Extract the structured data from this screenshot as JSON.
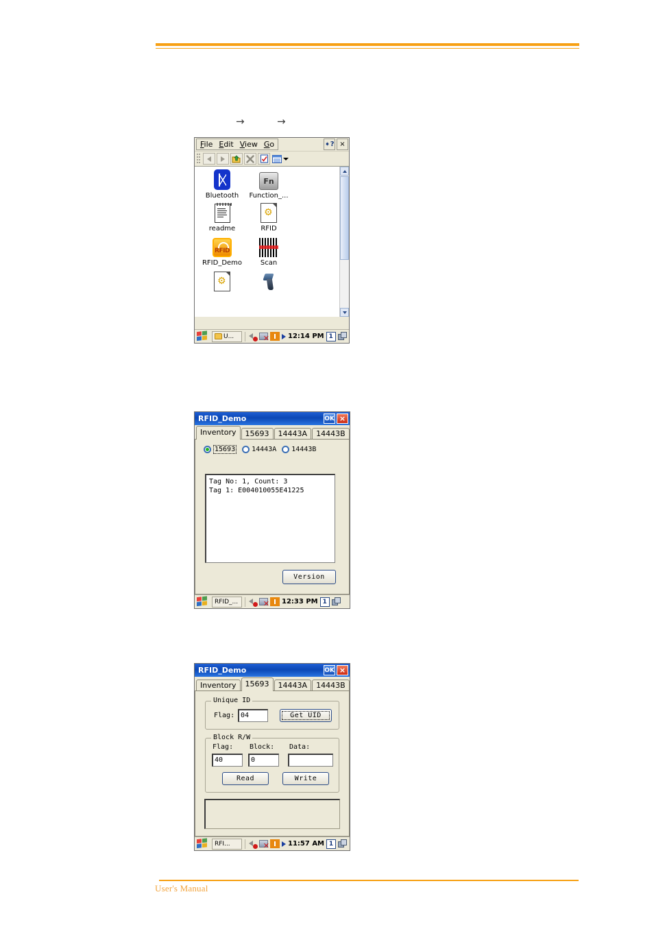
{
  "document": {
    "footer_text": "User's Manual",
    "arrows": [
      "→",
      "→"
    ]
  },
  "explorer_window": {
    "menu": [
      {
        "label": "File",
        "accel": "F"
      },
      {
        "label": "Edit",
        "accel": "E"
      },
      {
        "label": "View",
        "accel": "V"
      },
      {
        "label": "Go",
        "accel": "G"
      }
    ],
    "title_buttons": {
      "help": "?",
      "close": "×"
    },
    "toolbar": [
      "back-button",
      "forward-button",
      "up-one-level-button",
      "delete-button",
      "properties-button",
      "views-button"
    ],
    "icons": [
      {
        "label": "Bluetooth",
        "icon": "bluetooth-icon"
      },
      {
        "label": "Function_...",
        "icon": "function-key-icon"
      },
      {
        "label": "readme",
        "icon": "text-document-icon"
      },
      {
        "label": "RFID",
        "icon": "config-document-icon"
      },
      {
        "label": "RFID_Demo",
        "icon": "rfid-demo-icon"
      },
      {
        "label": "Scan",
        "icon": "barcode-icon"
      },
      {
        "label": "",
        "icon": "config-document-icon"
      },
      {
        "label": "",
        "icon": "scanner-gun-icon"
      }
    ],
    "taskbar": {
      "start": "start-button",
      "task_label": "U...",
      "tray": [
        "speaker-mute-icon",
        "network-disconnected-icon",
        "rfid-radio-icon",
        "play-icon"
      ],
      "clock": "12:14 PM",
      "ime": "1",
      "desktop": "show-desktop-icon"
    }
  },
  "demo_inventory_window": {
    "title": "RFID_Demo",
    "title_buttons": {
      "ok": "OK",
      "close": "×"
    },
    "tabs": [
      {
        "label": "Inventory",
        "active": true
      },
      {
        "label": "15693",
        "active": false
      },
      {
        "label": "14443A",
        "active": false
      },
      {
        "label": "14443B",
        "active": false
      }
    ],
    "radios": [
      {
        "label": "15693",
        "selected": true
      },
      {
        "label": "14443A",
        "selected": false
      },
      {
        "label": "14443B",
        "selected": false
      }
    ],
    "log_lines": [
      "Tag No: 1, Count: 3",
      "Tag 1: E004010055E41225"
    ],
    "version_button": "Version",
    "taskbar": {
      "task_label": "RFID_...",
      "clock": "12:33 PM",
      "ime": "1"
    }
  },
  "demo_15693_window": {
    "title": "RFID_Demo",
    "title_buttons": {
      "ok": "OK",
      "close": "×"
    },
    "tabs": [
      {
        "label": "Inventory",
        "active": false
      },
      {
        "label": "15693",
        "active": true
      },
      {
        "label": "14443A",
        "active": false
      },
      {
        "label": "14443B",
        "active": false
      }
    ],
    "unique_id": {
      "group_title": "Unique ID",
      "flag_label": "Flag:",
      "flag_value": "04",
      "get_uid_button": "Get UID"
    },
    "block_rw": {
      "group_title": "Block R/W",
      "flag_label": "Flag:",
      "flag_value": "40",
      "block_label": "Block:",
      "block_value": "0",
      "data_label": "Data:",
      "data_value": "",
      "read_button": "Read",
      "write_button": "Write"
    },
    "output_text": "",
    "taskbar": {
      "task_label": "RFI...",
      "clock": "11:57 AM",
      "ime": "1"
    }
  },
  "colors": {
    "accent_orange": "#f7a013",
    "title_blue": "#0c47b5",
    "window_face": "#ece9d8"
  }
}
